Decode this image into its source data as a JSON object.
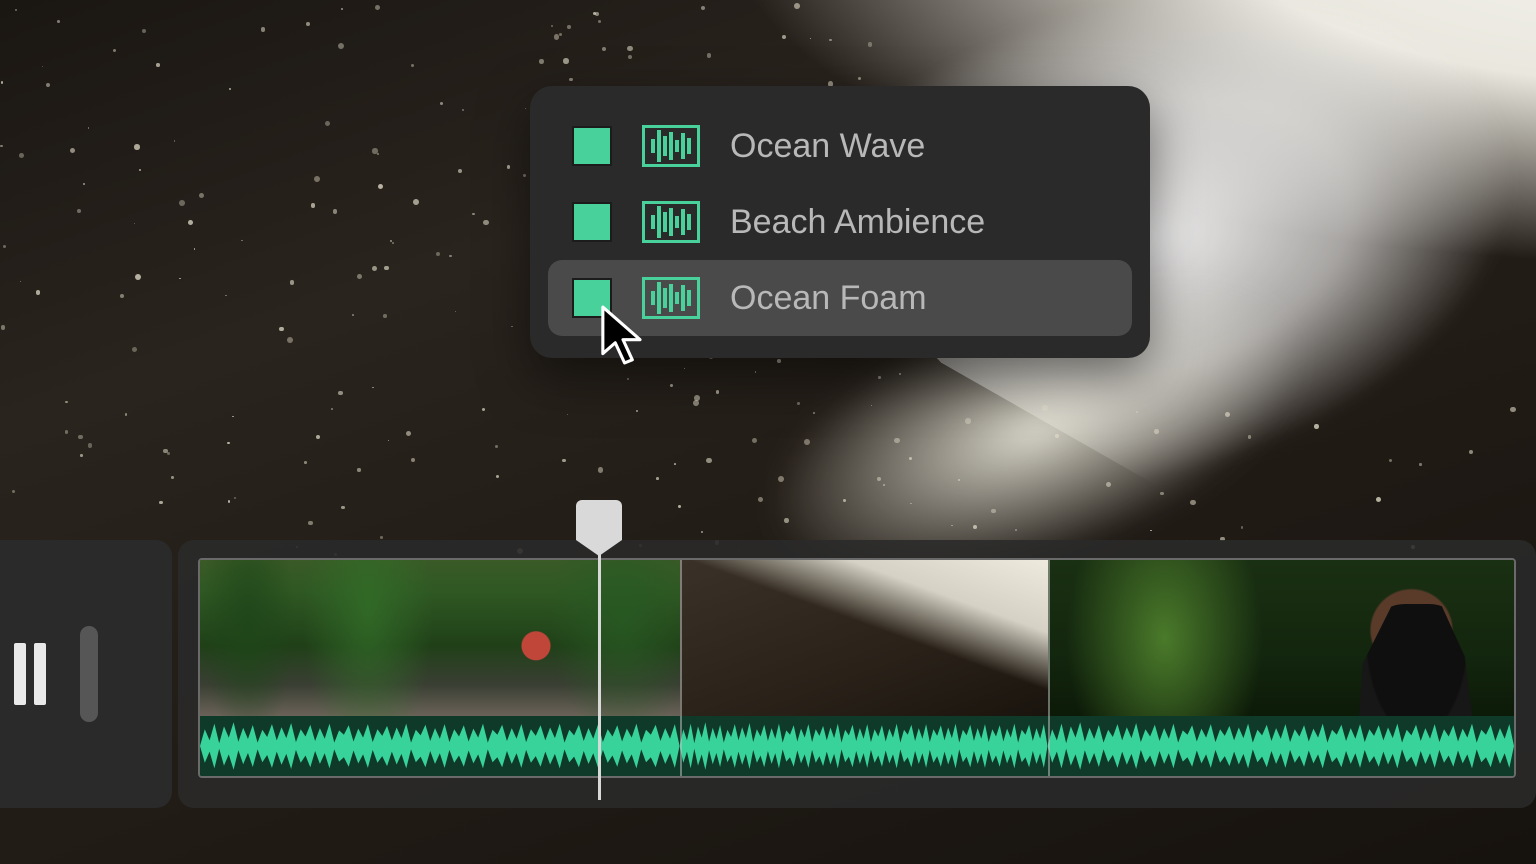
{
  "colors": {
    "accent": "#49d19b",
    "menuBg": "#2a2a2a",
    "menuHover": "#4a4a4a",
    "text": "#b8b8b8"
  },
  "menu": {
    "items": [
      {
        "label": "Ocean Wave",
        "chip": "#49d19b",
        "icon": "#49d19b",
        "hovered": false
      },
      {
        "label": "Beach Ambience",
        "chip": "#49d19b",
        "icon": "#49d19b",
        "hovered": false
      },
      {
        "label": "Ocean Foam",
        "chip": "#49d19b",
        "icon": "#49d19b",
        "hovered": true
      }
    ]
  },
  "timeline": {
    "playing": true,
    "clips": [
      {
        "name": "jungle",
        "start": 0,
        "end": 0.365
      },
      {
        "name": "beach",
        "start": 0.365,
        "end": 0.645
      },
      {
        "name": "portrait",
        "start": 0.645,
        "end": 1.0
      }
    ],
    "playheadFrac": 0.365
  }
}
